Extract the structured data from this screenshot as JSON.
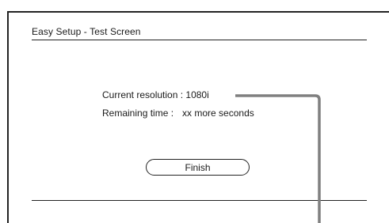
{
  "screen": {
    "title": "Easy Setup - Test Screen"
  },
  "info": {
    "resolution_label": "Current resolution : ",
    "resolution_value": "1080i",
    "remaining_label": "Remaining time :",
    "remaining_value": "xx more seconds"
  },
  "actions": {
    "finish_label": "Finish"
  },
  "colors": {
    "frame": "#222222",
    "callout_line": "#808080",
    "background": "#ffffff"
  }
}
